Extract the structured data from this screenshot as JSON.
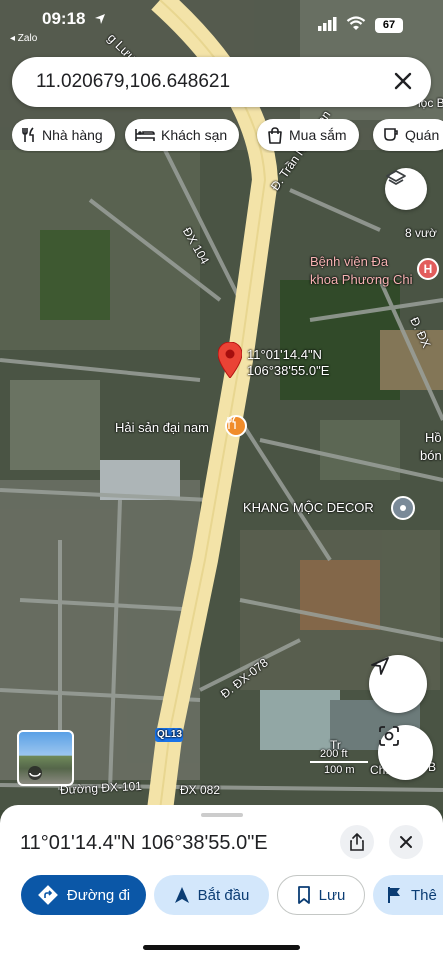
{
  "status": {
    "time": "09:18",
    "back_app": "◂ Zalo",
    "battery": "67"
  },
  "search": {
    "value": "11.020679,106.648621"
  },
  "chips": [
    {
      "label": "Nhà hàng",
      "icon": "restaurant-icon"
    },
    {
      "label": "Khách sạn",
      "icon": "hotel-icon"
    },
    {
      "label": "Mua sắm",
      "icon": "shopping-bag-icon"
    },
    {
      "label": "Quán",
      "icon": "cafe-icon"
    }
  ],
  "map": {
    "pin_lat": "11°01'14.4\"N",
    "pin_lng": "106°38'55.0\"E",
    "streets": {
      "tran_ngoc_lan": "Đ. Trần Ngọc Lan",
      "dx104": "ĐX 104",
      "dx078": "Đ. ĐX-078",
      "dx101": "Đường ĐX-101",
      "dx082": "ĐX 082",
      "ql13": "QL13",
      "top_road": "g Lưu",
      "right_dx": "Đ. ĐX"
    },
    "places": {
      "hospital": "Bệnh viện Đa khoa Phương Chi",
      "seafood": "Hải sản đại nam",
      "decor": "KHANG MỘC DECOR",
      "vuon": "8 vườ",
      "right_ho": "Hồ",
      "right_bon": "bón",
      "top_right": "iọc B",
      "bottom_right_1": "Tr",
      "bottom_right_2": "Ch...em",
      "bottom_right_3": "u B"
    },
    "scale": {
      "ft": "200 ft",
      "m": "100 m"
    },
    "colors": {
      "pin": "#ea4335",
      "road": "#f3e3a8",
      "hospital": "#e25c5c",
      "restaurant": "#f08c2b"
    }
  },
  "sheet": {
    "coords": "11°01'14.4\"N 106°38'55.0\"E",
    "buttons": [
      {
        "label": "Đường đi",
        "icon": "directions-icon"
      },
      {
        "label": "Bắt đầu",
        "icon": "navigation-arrow-icon"
      },
      {
        "label": "Lưu",
        "icon": "bookmark-icon"
      },
      {
        "label": "Thê",
        "icon": "flag-icon"
      }
    ]
  }
}
